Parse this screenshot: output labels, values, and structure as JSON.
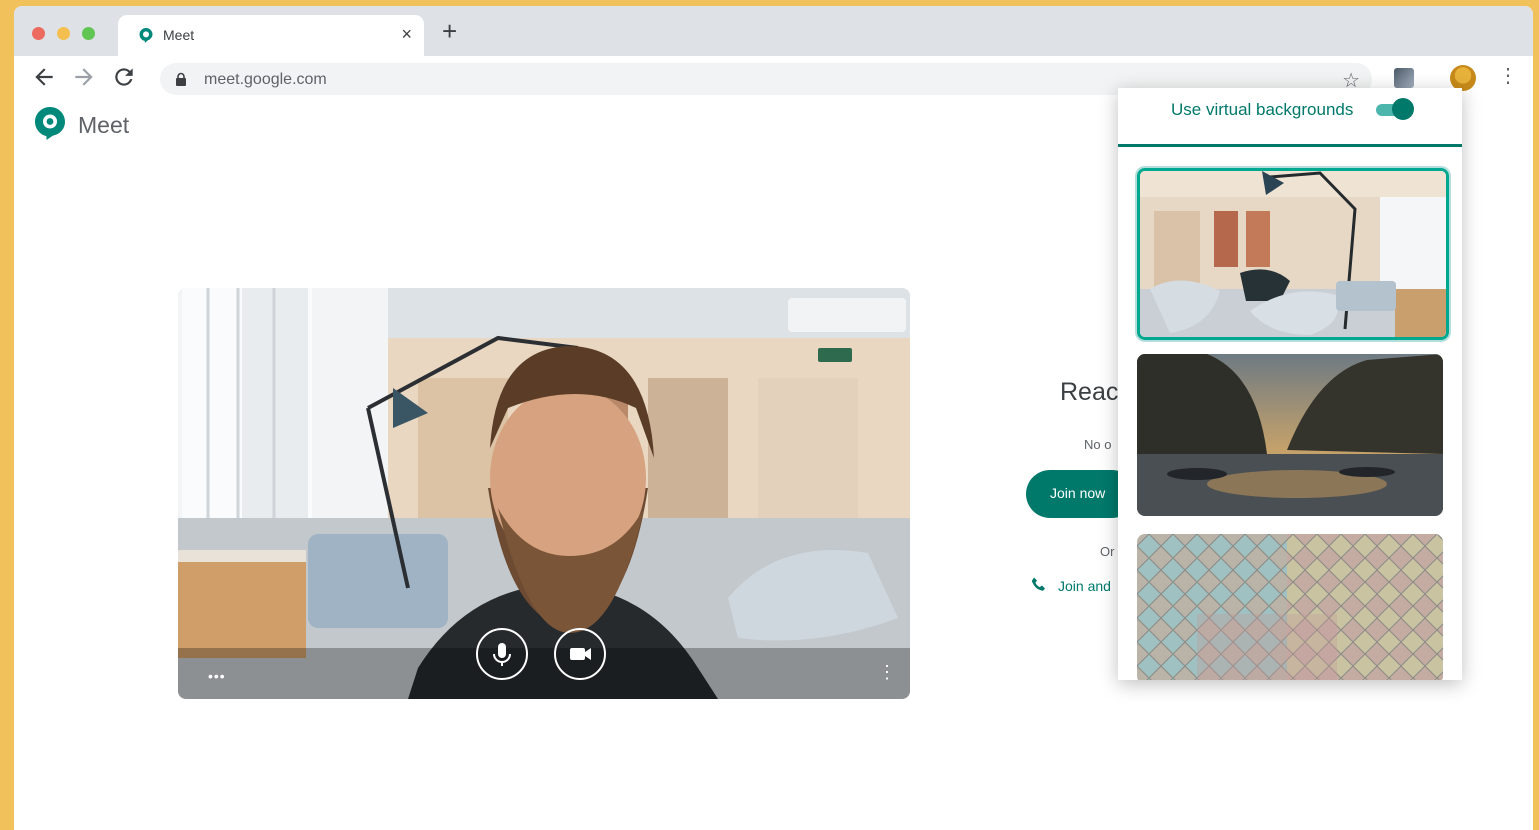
{
  "browser": {
    "tab_title": "Meet",
    "url": "meet.google.com"
  },
  "app": {
    "name": "Meet"
  },
  "join_panel": {
    "heading_partial": "Reac",
    "subtext_partial": "No o",
    "join_button_partial": "Join now",
    "or_partial": "Or",
    "phone_partial": "Join and"
  },
  "virtual_backgrounds": {
    "toggle_label": "Use virtual backgrounds",
    "enabled": true,
    "options": [
      "office",
      "sea-rocks",
      "tiles"
    ],
    "selected": "office"
  },
  "colors": {
    "accent": "#00796b",
    "toggle_track": "#4db6ac",
    "page_border": "#f1c25b"
  }
}
